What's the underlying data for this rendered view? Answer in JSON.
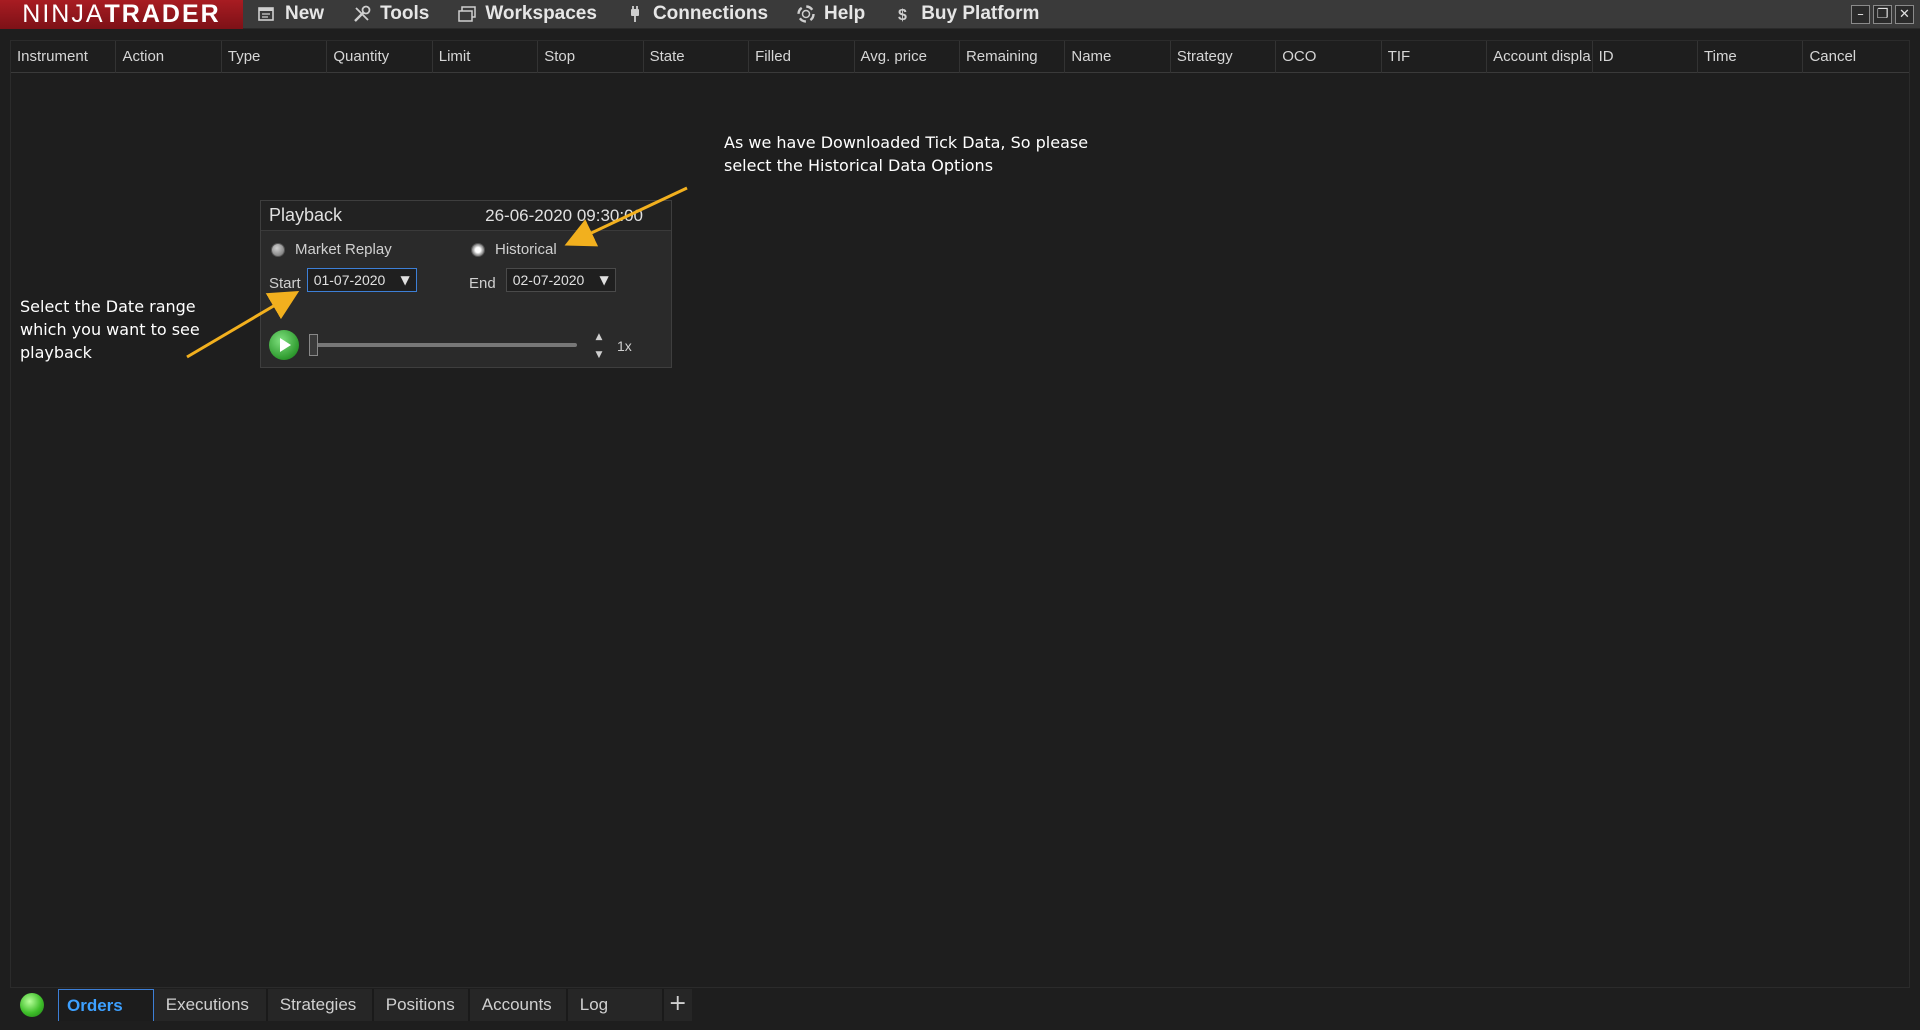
{
  "app": {
    "logo_left": "NINJA",
    "logo_right": "TRADER",
    "menu": [
      {
        "label": "New",
        "icon": "new-window-icon"
      },
      {
        "label": "Tools",
        "icon": "tools-icon"
      },
      {
        "label": "Workspaces",
        "icon": "workspaces-icon"
      },
      {
        "label": "Connections",
        "icon": "connections-plug-icon"
      },
      {
        "label": "Help",
        "icon": "help-lifebuoy-icon"
      },
      {
        "label": "Buy Platform",
        "icon": "dollar-icon"
      }
    ],
    "window_controls": {
      "minimize": "–",
      "restore": "❐",
      "close": "✕"
    }
  },
  "grid": {
    "columns": [
      "Instrument",
      "Action",
      "Type",
      "Quantity",
      "Limit",
      "Stop",
      "State",
      "Filled",
      "Avg. price",
      "Remaining",
      "Name",
      "Strategy",
      "OCO",
      "TIF",
      "Account displa",
      "ID",
      "Time",
      "Cancel"
    ]
  },
  "playback": {
    "title": "Playback",
    "datetime": "26-06-2020 09:30:00",
    "mode_market_replay": "Market Replay",
    "mode_historical": "Historical",
    "start_label": "Start",
    "start_value": "01-07-2020",
    "end_label": "End",
    "end_value": "02-07-2020",
    "speed": "1x",
    "selected_mode": "Historical"
  },
  "annotations": {
    "top_note_line1": "As we have Downloaded Tick Data, So please",
    "top_note_line2": "select the Historical Data Options",
    "left_note_line1": "Select the Date range",
    "left_note_line2": "which you want to see",
    "left_note_line3": "playback",
    "arrow_color": "#f2b01e"
  },
  "tabs": [
    "Orders",
    "Executions",
    "Strategies",
    "Positions",
    "Accounts",
    "Log"
  ],
  "tab_add": "+",
  "colors": {
    "logo_bg": "#a81c22",
    "active_tab": "#3da0ff",
    "status_green": "#3fbf2a"
  }
}
